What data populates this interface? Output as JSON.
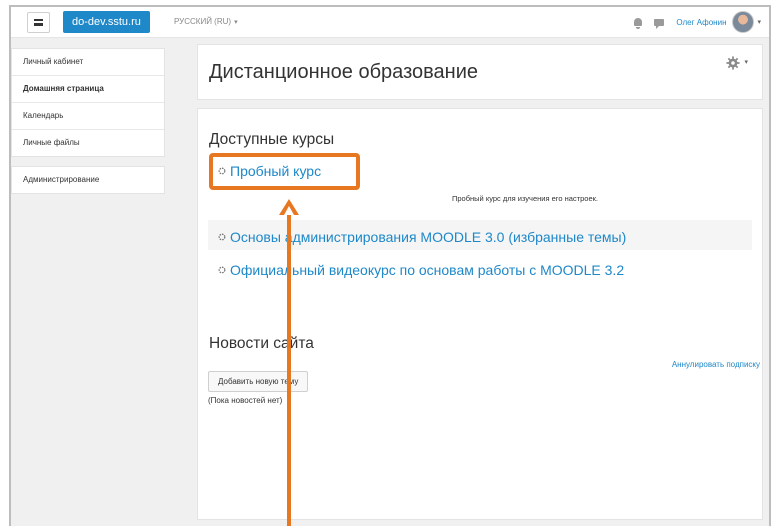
{
  "navbar": {
    "brand": "do-dev.sstu.ru",
    "language": "РУССКИЙ (RU)",
    "user_name": "Олег Афонин"
  },
  "sidebar": {
    "items": [
      {
        "label": "Личный кабинет",
        "active": false
      },
      {
        "label": "Домашняя страница",
        "active": true
      },
      {
        "label": "Календарь",
        "active": false
      },
      {
        "label": "Личные файлы",
        "active": false
      }
    ],
    "admin_label": "Администрирование"
  },
  "header": {
    "title": "Дистанционное образование"
  },
  "courses": {
    "section_title": "Доступные курсы",
    "items": [
      {
        "name": "Пробный курс",
        "description": "Пробный курс для изучения его настроек."
      },
      {
        "name": "Основы администрирования MOODLE 3.0 (избранные темы)"
      },
      {
        "name": "Официальный видеокурс по основам работы с MOODLE 3.2"
      }
    ]
  },
  "news": {
    "section_title": "Новости сайта",
    "unsubscribe": "Аннулировать подписку",
    "add_topic": "Добавить новую тему",
    "empty": "(Пока новостей нет)"
  },
  "colors": {
    "accent": "#1e88c8",
    "annotation": "#e87722"
  }
}
